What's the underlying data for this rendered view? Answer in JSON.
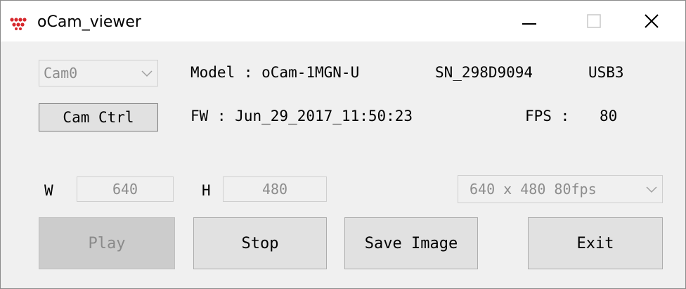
{
  "window": {
    "title": "oCam_viewer",
    "icon": "ocam-logo-icon",
    "controls": {
      "minimize": "minimize-icon",
      "maximize": "maximize-icon",
      "close": "close-icon"
    }
  },
  "camera_select": {
    "value": "Cam0"
  },
  "cam_ctrl_button": {
    "label": "Cam Ctrl"
  },
  "info": {
    "model": "Model : oCam-1MGN-U",
    "serial": "SN_298D9094",
    "interface": "USB3",
    "firmware": "FW : Jun_29_2017_11:50:23",
    "fps_label": "FPS :",
    "fps_value": "80"
  },
  "resolution": {
    "width_label": "W",
    "width_value": "640",
    "height_label": "H",
    "height_value": "480",
    "mode_value": "640 x 480  80fps"
  },
  "buttons": {
    "play": "Play",
    "stop": "Stop",
    "save_image": "Save Image",
    "exit": "Exit"
  },
  "colors": {
    "logo_red": "#d6262b",
    "window_bg": "#f0f0f0",
    "button_bg": "#e1e1e1",
    "disabled_text": "#8a8a8a"
  }
}
